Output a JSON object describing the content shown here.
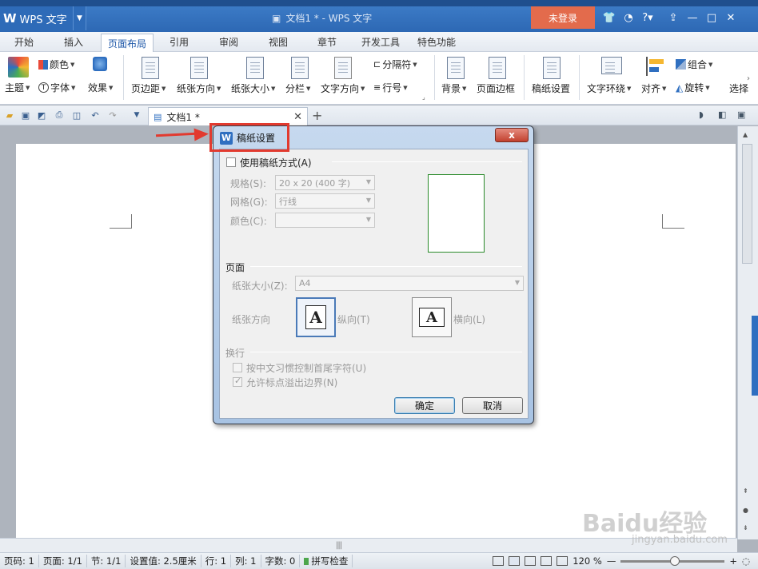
{
  "app": {
    "menu_label": "WPS 文字",
    "doc_title": "文档1 * - WPS 文字",
    "login_label": "未登录"
  },
  "tabs": [
    "开始",
    "插入",
    "页面布局",
    "引用",
    "审阅",
    "视图",
    "章节",
    "开发工具",
    "特色功能"
  ],
  "active_tab": "页面布局",
  "ribbon": {
    "theme": "主题",
    "color": "颜色",
    "font": "字体",
    "effect": "效果",
    "margins": "页边距",
    "orientation": "纸张方向",
    "size": "纸张大小",
    "columns": "分栏",
    "text_dir": "文字方向",
    "separator": "分隔符",
    "line_num": "行号",
    "background": "背景",
    "border": "页面边框",
    "draft": "稿纸设置",
    "wrap": "文字环绕",
    "align": "对齐",
    "group": "组合",
    "rotate": "旋转",
    "select": "选择"
  },
  "doc_tab": {
    "label": "文档1 *"
  },
  "dialog": {
    "title": "稿纸设置",
    "close": "x",
    "use_draft": "使用稿纸方式(A)",
    "spec_label": "规格(S):",
    "spec_value": "20 x 20 (400 字)",
    "grid_label": "网格(G):",
    "grid_value": "行线",
    "color_label": "颜色(C):",
    "color_value": "",
    "page_group": "页面",
    "paper_size_label": "纸张大小(Z):",
    "paper_size_value": "A4",
    "orientation_label": "纸张方向",
    "portrait": "纵向(T)",
    "landscape": "横向(L)",
    "orient_glyph": "A",
    "wrap_group": "换行",
    "opt1": "按中文习惯控制首尾字符(U)",
    "opt2": "允许标点溢出边界(N)",
    "ok": "确定",
    "cancel": "取消"
  },
  "status": {
    "page": "页码: 1",
    "pages": "页面: 1/1",
    "section": "节: 1/1",
    "setting": "设置值: 2.5厘米",
    "row": "行: 1",
    "col": "列: 1",
    "words": "字数: 0",
    "spell": "拼写检查",
    "zoom": "120 %"
  },
  "watermark": {
    "brand": "Baidu经验",
    "url": "jingyan.baidu.com"
  },
  "colors": {
    "title_bar": "#2d68b4",
    "login": "#e36b4c",
    "highlight": "#e23a2f"
  }
}
